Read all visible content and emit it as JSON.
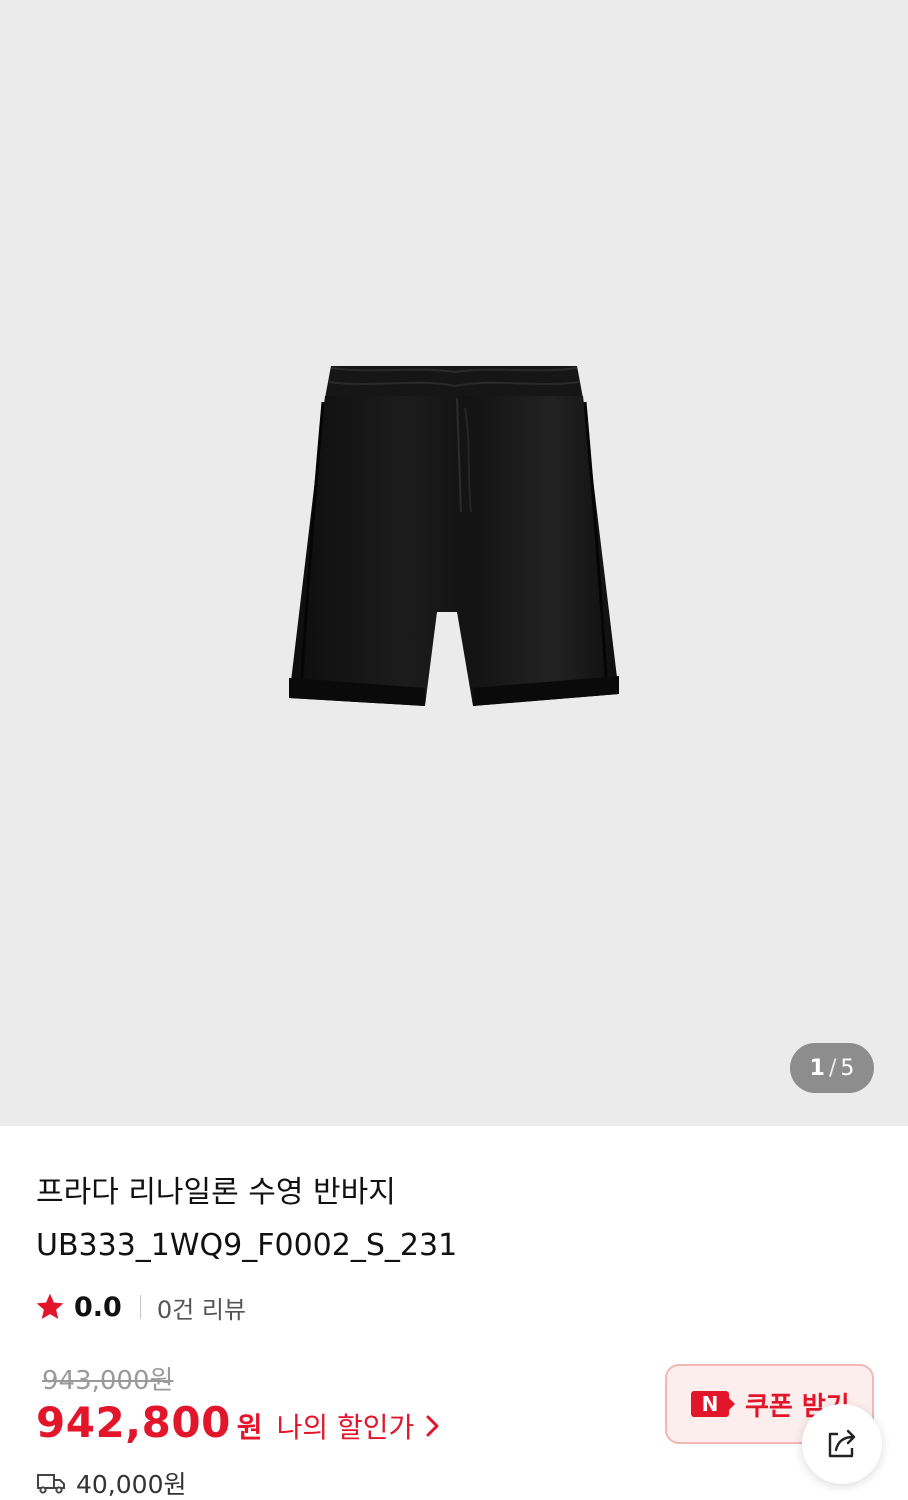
{
  "gallery": {
    "current_page": "1",
    "separator": "/",
    "total_pages": "5"
  },
  "product": {
    "title_line1": "프라다 리나일론 수영 반바지",
    "title_line2": "UB333_1WQ9_F0002_S_231",
    "rating": "0.0",
    "review_count": "0건 리뷰",
    "original_price": "943,000원",
    "sale_price": "942,800",
    "sale_unit": "원",
    "my_price_label": "나의 할인가",
    "shipping_fee": "40,000원"
  },
  "coupon": {
    "badge": "N",
    "label": "쿠폰 받기"
  },
  "colors": {
    "accent": "#e3152b",
    "gallery_bg": "#ebebeb",
    "coupon_bg": "#fdeeee"
  },
  "icons": [
    "star-icon",
    "chevron-right-icon",
    "truck-icon",
    "n-badge-icon",
    "share-icon"
  ]
}
